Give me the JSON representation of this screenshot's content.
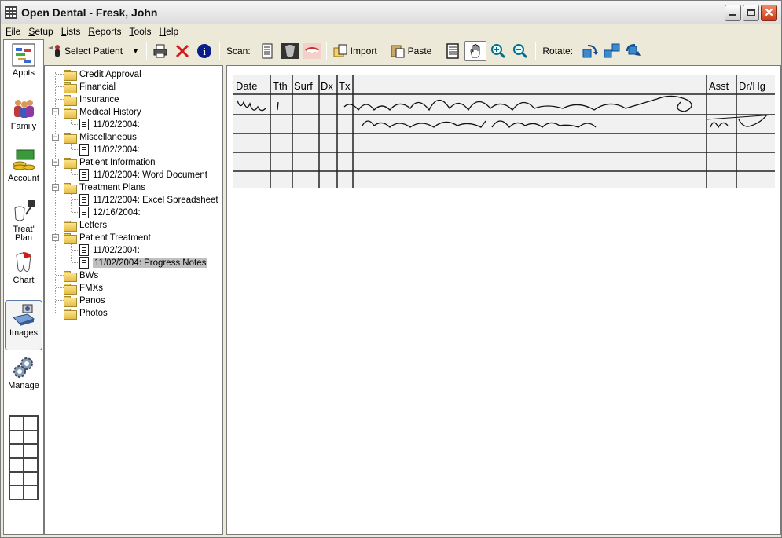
{
  "window": {
    "title": "Open Dental - Fresk, John"
  },
  "menu": {
    "items": [
      "File",
      "Setup",
      "Lists",
      "Reports",
      "Tools",
      "Help"
    ],
    "underline": [
      "F",
      "S",
      "L",
      "R",
      "T",
      "H"
    ]
  },
  "toolbar": {
    "select_patient": "Select Patient",
    "scan_label": "Scan:",
    "import_label": "Import",
    "paste_label": "Paste",
    "rotate_label": "Rotate:"
  },
  "modules": [
    {
      "label": "Appts",
      "icon": "calendar-icon"
    },
    {
      "label": "Family",
      "icon": "family-icon"
    },
    {
      "label": "Account",
      "icon": "money-icon"
    },
    {
      "label": "Treat' Plan",
      "icon": "treat-plan-icon"
    },
    {
      "label": "Chart",
      "icon": "tooth-icon"
    },
    {
      "label": "Images",
      "icon": "scanner-icon"
    },
    {
      "label": "Manage",
      "icon": "gear-icon"
    }
  ],
  "tree": [
    {
      "label": "Credit Approval",
      "type": "folder",
      "level": 0
    },
    {
      "label": "Financial",
      "type": "folder",
      "level": 0
    },
    {
      "label": "Insurance",
      "type": "folder",
      "level": 0
    },
    {
      "label": "Medical History",
      "type": "folder",
      "level": 0,
      "expanded": true
    },
    {
      "label": "11/02/2004:",
      "type": "doc",
      "level": 1
    },
    {
      "label": "Miscellaneous",
      "type": "folder",
      "level": 0,
      "expanded": true
    },
    {
      "label": "11/02/2004:",
      "type": "doc",
      "level": 1
    },
    {
      "label": "Patient Information",
      "type": "folder",
      "level": 0,
      "expanded": true
    },
    {
      "label": "11/02/2004: Word Document",
      "type": "doc",
      "level": 1
    },
    {
      "label": "Treatment Plans",
      "type": "folder",
      "level": 0,
      "expanded": true
    },
    {
      "label": "11/12/2004: Excel Spreadsheet",
      "type": "doc",
      "level": 1
    },
    {
      "label": "12/16/2004:",
      "type": "doc",
      "level": 1
    },
    {
      "label": "Letters",
      "type": "folder",
      "level": 0
    },
    {
      "label": "Patient Treatment",
      "type": "folder",
      "level": 0,
      "expanded": true
    },
    {
      "label": "11/02/2004:",
      "type": "doc",
      "level": 1
    },
    {
      "label": "11/02/2004: Progress Notes",
      "type": "doc",
      "level": 1,
      "selected": true
    },
    {
      "label": "BWs",
      "type": "folder",
      "level": 0
    },
    {
      "label": "FMXs",
      "type": "folder",
      "level": 0
    },
    {
      "label": "Panos",
      "type": "folder",
      "level": 0
    },
    {
      "label": "Photos",
      "type": "folder",
      "level": 0
    }
  ],
  "progress_notes": {
    "headers": [
      "Date",
      "Tth",
      "Surf",
      "Dx",
      "Tx",
      "Asst",
      "Dr/Hg"
    ]
  }
}
